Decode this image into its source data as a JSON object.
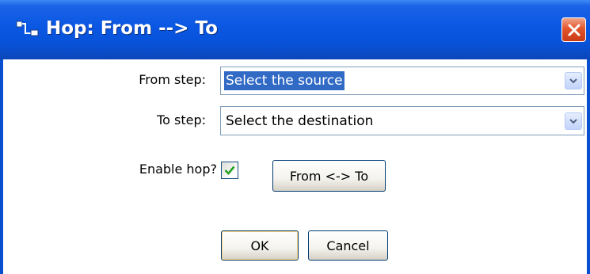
{
  "window": {
    "title": "Hop: From --> To",
    "title_icon": "hop-icon",
    "close_icon": "close-icon"
  },
  "form": {
    "from_label": "From step:",
    "from_value": "Select the source",
    "to_label": "To step:",
    "to_value": "Select the destination",
    "enable_label": "Enable hop?",
    "enable_checked": true,
    "swap_button": "From <-> To"
  },
  "buttons": {
    "ok": "OK",
    "cancel": "Cancel"
  },
  "colors": {
    "titlebar": "#0a57e3",
    "close": "#e2552c",
    "selection": "#316ac5",
    "checkmark": "#21a121"
  }
}
